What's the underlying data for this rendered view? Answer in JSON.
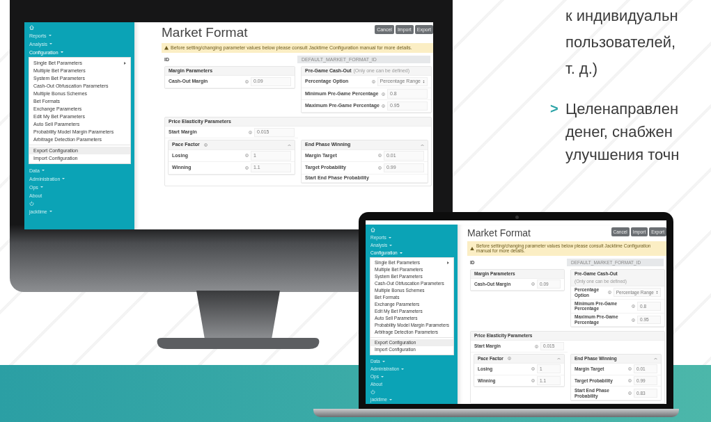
{
  "monitor_screen": {
    "sidebar": [
      {
        "kind": "home"
      },
      {
        "kind": "menu",
        "label": "Reports",
        "expanded": false
      },
      {
        "kind": "menu",
        "label": "Analysis",
        "expanded": false
      },
      {
        "kind": "menu",
        "label": "Configuration",
        "expanded": true,
        "menu": [
          [
            {
              "label": "Single Bet Parameters",
              "submenu": true,
              "highlighted": false
            },
            {
              "label": "Multiple Bet Parameters",
              "submenu": false,
              "highlighted": false
            },
            {
              "label": "System Bet Parameters",
              "submenu": false,
              "highlighted": false
            },
            {
              "label": "Cash-Out Obfuscation Parameters",
              "submenu": false,
              "highlighted": false
            },
            {
              "label": "Multiple Bonus Schemes",
              "submenu": false,
              "highlighted": false
            },
            {
              "label": "Bet Formats",
              "submenu": false,
              "highlighted": false
            },
            {
              "label": "Exchange Parameters",
              "submenu": false,
              "highlighted": false
            },
            {
              "label": "Edit My Bet Parameters",
              "submenu": false,
              "highlighted": false
            },
            {
              "label": "Auto Sell Parameters",
              "submenu": false,
              "highlighted": false
            },
            {
              "label": "Probability Model Margin Parameters",
              "submenu": false,
              "highlighted": false
            },
            {
              "label": "Arbitrage Detection Parameters",
              "submenu": false,
              "highlighted": false
            }
          ],
          [
            {
              "label": "Export Configuration",
              "submenu": false,
              "highlighted": true
            },
            {
              "label": "Import Configuration",
              "submenu": false,
              "highlighted": false
            }
          ]
        ]
      },
      {
        "kind": "menu",
        "label": "Data",
        "expanded": false
      },
      {
        "kind": "menu",
        "label": "Administration",
        "expanded": false
      },
      {
        "kind": "menu",
        "label": "Ops",
        "expanded": false
      },
      {
        "kind": "link",
        "label": "About"
      },
      {
        "kind": "power"
      },
      {
        "kind": "menu",
        "label": "jacktime",
        "expanded": false
      }
    ],
    "title": "Market Format",
    "buttons": [
      "Cancel",
      "Import",
      "Export"
    ],
    "alert": "Before setting/changing parameter values below please consult Jacktime Configuration manual for more details.",
    "id_field": {
      "label": "ID",
      "value": "DEFAULT_MARKET_FORMAT_ID"
    },
    "panels": [
      {
        "title": "Margin Parameters",
        "rows": [
          {
            "kind": "input",
            "label": "Cash-Out Margin",
            "value": "0.09"
          }
        ]
      },
      {
        "title": "Pre-Game Cash-Out",
        "note": "(Only one can be defined)",
        "rows": [
          {
            "kind": "select",
            "label": "Percentage Option",
            "value": "Percentage Range"
          },
          {
            "kind": "input",
            "label": "Minimum Pre-Game Percentage",
            "value": "0.8"
          },
          {
            "kind": "input",
            "label": "Maximum Pre-Game Percentage",
            "value": "0.95"
          }
        ]
      }
    ],
    "price_panel": {
      "title": "Price Elasticity Parameters",
      "rows": [
        {
          "kind": "input",
          "label": "Start Margin",
          "value": "0.015"
        }
      ],
      "subpanels": [
        {
          "title": "Pace Factor",
          "info": true,
          "expanded": true,
          "rows": [
            {
              "kind": "input",
              "label": "Losing",
              "value": "1"
            },
            {
              "kind": "input",
              "label": "Winning",
              "value": "1.1"
            }
          ]
        },
        {
          "title": "End Phase Winning",
          "info": false,
          "expanded": true,
          "rows": [
            {
              "kind": "input",
              "label": "Margin Target",
              "value": "0.01"
            },
            {
              "kind": "input",
              "label": "Target Probability",
              "value": "0.99"
            },
            {
              "kind": "hidden",
              "label": "Start End Phase Probability"
            }
          ]
        }
      ]
    }
  },
  "laptop_screen": {
    "sidebar": [
      {
        "kind": "home"
      },
      {
        "kind": "menu",
        "label": "Reports",
        "expanded": false
      },
      {
        "kind": "menu",
        "label": "Analysis",
        "expanded": false
      },
      {
        "kind": "menu",
        "label": "Configuration",
        "expanded": true,
        "menu": [
          [
            {
              "label": "Single Bet Parameters",
              "submenu": true,
              "highlighted": false
            },
            {
              "label": "Multiple Bet Parameters",
              "submenu": false,
              "highlighted": false
            },
            {
              "label": "System Bet Parameters",
              "submenu": false,
              "highlighted": false
            },
            {
              "label": "Cash-Out Obfuscation Parameters",
              "submenu": false,
              "highlighted": false
            },
            {
              "label": "Multiple Bonus Schemes",
              "submenu": false,
              "highlighted": false
            },
            {
              "label": "Bet Formats",
              "submenu": false,
              "highlighted": false
            },
            {
              "label": "Exchange Parameters",
              "submenu": false,
              "highlighted": false
            },
            {
              "label": "Edit My Bet Parameters",
              "submenu": false,
              "highlighted": false
            },
            {
              "label": "Auto Sell Parameters",
              "submenu": false,
              "highlighted": false
            },
            {
              "label": "Probability Model Margin Parameters",
              "submenu": false,
              "highlighted": false
            },
            {
              "label": "Arbitrage Detection Parameters",
              "submenu": false,
              "highlighted": false
            }
          ],
          [
            {
              "label": "Export Configuration",
              "submenu": false,
              "highlighted": true
            },
            {
              "label": "Import Configuration",
              "submenu": false,
              "highlighted": false
            }
          ]
        ]
      },
      {
        "kind": "menu",
        "label": "Data",
        "expanded": false
      },
      {
        "kind": "menu",
        "label": "Administration",
        "expanded": false
      },
      {
        "kind": "menu",
        "label": "Ops",
        "expanded": false
      },
      {
        "kind": "link",
        "label": "About"
      },
      {
        "kind": "power"
      },
      {
        "kind": "menu",
        "label": "jacktime",
        "expanded": false
      }
    ],
    "title": "Market Format",
    "buttons": [
      "Cancel",
      "Import",
      "Export"
    ],
    "alert": "Before setting/changing parameter values below please consult Jacktime Configuration manual for more details.",
    "id_field": {
      "label": "ID",
      "value": "DEFAULT_MARKET_FORMAT_ID"
    },
    "panels": [
      {
        "title": "Margin Parameters",
        "rows": [
          {
            "kind": "input",
            "label": "Cash-Out Margin",
            "value": "0.09"
          }
        ]
      },
      {
        "title": "Pre-Game Cash-Out",
        "note": "(Only one can be defined)",
        "rows": [
          {
            "kind": "select",
            "label": "Percentage Option",
            "value": "Percentage Range"
          },
          {
            "kind": "input",
            "label": "Minimum Pre-Game Percentage",
            "value": "0.8"
          },
          {
            "kind": "input",
            "label": "Maximum Pre-Game Percentage",
            "value": "0.95"
          }
        ]
      }
    ],
    "price_panel": {
      "title": "Price Elasticity Parameters",
      "rows": [
        {
          "kind": "input",
          "label": "Start Margin",
          "value": "0.015"
        }
      ],
      "subpanels": [
        {
          "title": "Pace Factor",
          "info": true,
          "expanded": true,
          "rows": [
            {
              "kind": "input",
              "label": "Losing",
              "value": "1"
            },
            {
              "kind": "input",
              "label": "Winning",
              "value": "1.1"
            }
          ]
        },
        {
          "title": "End Phase Winning",
          "info": false,
          "expanded": true,
          "rows": [
            {
              "kind": "input",
              "label": "Margin Target",
              "value": "0.01"
            },
            {
              "kind": "input",
              "label": "Target Probability",
              "value": "0.99"
            },
            {
              "kind": "input",
              "label": "Start End Phase Probability",
              "value": "0.83"
            }
          ]
        }
      ]
    }
  },
  "text_block": {
    "lines": [
      "к индивидуальн",
      "пользователей,",
      "т. д.)"
    ],
    "bullet": {
      "marker": ">",
      "lines": [
        "Целенаправлен",
        "денег, снабжен",
        "улучшения точн"
      ]
    }
  }
}
